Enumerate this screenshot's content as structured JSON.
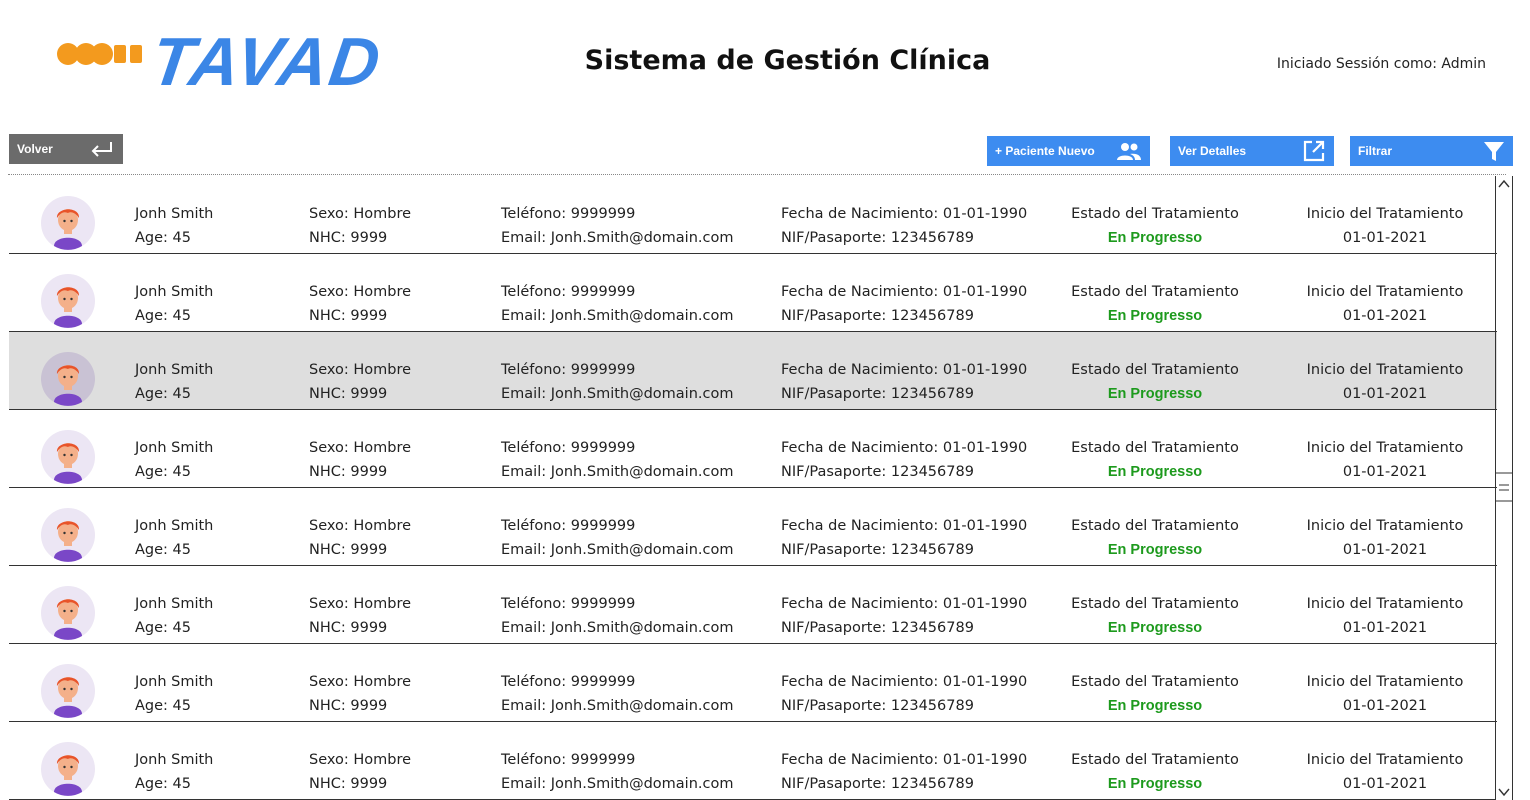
{
  "header": {
    "logo_text": "TAVAD",
    "title": "Sistema de Gestión Clínica",
    "user_label": "Iniciado Sessión como: Admin"
  },
  "toolbar": {
    "back_label": "Volver",
    "new_patient_label": "+ Paciente Nuevo",
    "details_label": "Ver Detalles",
    "filter_label": "Filtrar",
    "icons": {
      "back": "return-arrow-icon",
      "new_patient": "people-icon",
      "details": "open-external-icon",
      "filter": "funnel-icon"
    }
  },
  "colors": {
    "brand_blue": "#3b86e6",
    "button_blue": "#3d8cf0",
    "back_gray": "#6b6b6b",
    "status_green": "#1d9a1d",
    "selected_row": "#dedede"
  },
  "patients": [
    {
      "name": "Jonh Smith",
      "age": "Age: 45",
      "sex": "Sexo: Hombre",
      "nhc": "NHC: 9999",
      "phone": "Teléfono: 9999999",
      "email": "Email: Jonh.Smith@domain.com",
      "dob": "Fecha de Nacimiento: 01-01-1990",
      "nif": "NIF/Pasaporte: 123456789",
      "status_label": "Estado del Tratamiento",
      "status": "En Progresso",
      "start_label": "Inicio del Tratamiento",
      "start": "01-01-2021"
    },
    {
      "name": "Jonh Smith",
      "age": "Age: 45",
      "sex": "Sexo: Hombre",
      "nhc": "NHC: 9999",
      "phone": "Teléfono: 9999999",
      "email": "Email: Jonh.Smith@domain.com",
      "dob": "Fecha de Nacimiento: 01-01-1990",
      "nif": "NIF/Pasaporte: 123456789",
      "status_label": "Estado del Tratamiento",
      "status": "En Progresso",
      "start_label": "Inicio del Tratamiento",
      "start": "01-01-2021"
    },
    {
      "name": "Jonh Smith",
      "age": "Age: 45",
      "sex": "Sexo: Hombre",
      "nhc": "NHC: 9999",
      "phone": "Teléfono: 9999999",
      "email": "Email: Jonh.Smith@domain.com",
      "dob": "Fecha de Nacimiento: 01-01-1990",
      "nif": "NIF/Pasaporte: 123456789",
      "status_label": "Estado del Tratamiento",
      "status": "En Progresso",
      "start_label": "Inicio del Tratamiento",
      "start": "01-01-2021",
      "selected": true
    },
    {
      "name": "Jonh Smith",
      "age": "Age: 45",
      "sex": "Sexo: Hombre",
      "nhc": "NHC: 9999",
      "phone": "Teléfono: 9999999",
      "email": "Email: Jonh.Smith@domain.com",
      "dob": "Fecha de Nacimiento: 01-01-1990",
      "nif": "NIF/Pasaporte: 123456789",
      "status_label": "Estado del Tratamiento",
      "status": "En Progresso",
      "start_label": "Inicio del Tratamiento",
      "start": "01-01-2021"
    },
    {
      "name": "Jonh Smith",
      "age": "Age: 45",
      "sex": "Sexo: Hombre",
      "nhc": "NHC: 9999",
      "phone": "Teléfono: 9999999",
      "email": "Email: Jonh.Smith@domain.com",
      "dob": "Fecha de Nacimiento: 01-01-1990",
      "nif": "NIF/Pasaporte: 123456789",
      "status_label": "Estado del Tratamiento",
      "status": "En Progresso",
      "start_label": "Inicio del Tratamiento",
      "start": "01-01-2021"
    },
    {
      "name": "Jonh Smith",
      "age": "Age: 45",
      "sex": "Sexo: Hombre",
      "nhc": "NHC: 9999",
      "phone": "Teléfono: 9999999",
      "email": "Email: Jonh.Smith@domain.com",
      "dob": "Fecha de Nacimiento: 01-01-1990",
      "nif": "NIF/Pasaporte: 123456789",
      "status_label": "Estado del Tratamiento",
      "status": "En Progresso",
      "start_label": "Inicio del Tratamiento",
      "start": "01-01-2021"
    },
    {
      "name": "Jonh Smith",
      "age": "Age: 45",
      "sex": "Sexo: Hombre",
      "nhc": "NHC: 9999",
      "phone": "Teléfono: 9999999",
      "email": "Email: Jonh.Smith@domain.com",
      "dob": "Fecha de Nacimiento: 01-01-1990",
      "nif": "NIF/Pasaporte: 123456789",
      "status_label": "Estado del Tratamiento",
      "status": "En Progresso",
      "start_label": "Inicio del Tratamiento",
      "start": "01-01-2021"
    },
    {
      "name": "Jonh Smith",
      "age": "Age: 45",
      "sex": "Sexo: Hombre",
      "nhc": "NHC: 9999",
      "phone": "Teléfono: 9999999",
      "email": "Email: Jonh.Smith@domain.com",
      "dob": "Fecha de Nacimiento: 01-01-1990",
      "nif": "NIF/Pasaporte: 123456789",
      "status_label": "Estado del Tratamiento",
      "status": "En Progresso",
      "start_label": "Inicio del Tratamiento",
      "start": "01-01-2021"
    }
  ]
}
